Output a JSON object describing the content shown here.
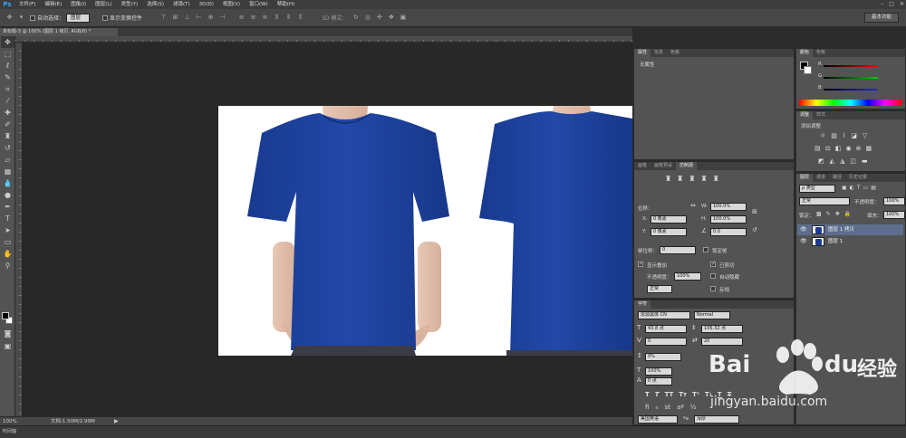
{
  "menubar": {
    "logo": "Ps",
    "items": [
      "文件(F)",
      "编辑(E)",
      "图像(I)",
      "图层(L)",
      "类型(Y)",
      "选择(S)",
      "滤镜(T)",
      "3D(D)",
      "视图(V)",
      "窗口(W)",
      "帮助(H)"
    ],
    "window_controls": [
      "–",
      "□",
      "✕"
    ]
  },
  "options": {
    "auto_select_label": "自动选择：",
    "auto_select_value": "图层",
    "show_transform_label": "显示变换控件",
    "mode_3d_label": "3D 模式：",
    "workspace": "基本功能"
  },
  "document": {
    "tab_title": "未标题-3 @ 100% (图层 1 拷贝, RGB/8) *"
  },
  "status": {
    "zoom": "100%",
    "doc_info": "文档:1.50M/2.99M",
    "timeline": "时间轴"
  },
  "panels": {
    "properties_tabs": [
      "属性",
      "信息",
      "色板"
    ],
    "properties_title": "无属性",
    "color_tabs": [
      "颜色",
      "色板"
    ],
    "color_labels": [
      "R",
      "G",
      "B"
    ],
    "adjust_tabs": [
      "调整",
      "样式"
    ],
    "adjust_title": "添加调整",
    "transform_tabs": [
      "画笔",
      "画笔预设",
      "仿制源"
    ],
    "offset_label": "位移：",
    "x_field": "0 像素",
    "y_field": "0 像素",
    "w_field": "100.0%",
    "h_field": "100.0%",
    "angle_field": "0.0",
    "frame_offset_label": "帧位移：",
    "frame_offset_value": "0",
    "lock_frame": "锁定帧",
    "show_overlay": "显示叠加",
    "opacity_label": "不透明度：",
    "opacity_value": "100%",
    "blend_value": "正常",
    "clipped": "已剪切",
    "auto_hide": "自动隐藏",
    "invert": "反相",
    "char_tabs": [
      "字符"
    ],
    "font_family": "思源黑体 CN",
    "font_style": "Normal",
    "font_size": "43.8 点",
    "leading": "106.32 点",
    "kerning": "0",
    "tracking": "20",
    "scale_v": "0%",
    "scale_h": "100%",
    "baseline": "0 点",
    "language": "美国英语",
    "aa_label": "ªa",
    "aa_value": "浑厚",
    "layers_tabs": [
      "图层",
      "通道",
      "路径",
      "历史记录"
    ],
    "layer_kind": "ρ 类型",
    "blend_mode": "正常",
    "layer_opacity_label": "不透明度：",
    "layer_opacity": "100%",
    "lock_label": "锁定：",
    "fill_label": "填充：",
    "fill_value": "100%",
    "layers": [
      {
        "name": "图层 1 拷贝",
        "selected": true
      },
      {
        "name": "图层 1",
        "selected": false
      }
    ]
  },
  "watermark": {
    "brand": "Bai",
    "brand2": "du",
    "text": "经验",
    "url": "jingyan.baidu.com"
  },
  "colors": {
    "shirt": "#1d3f99",
    "shirt_dark": "#142d73",
    "panel": "#535353",
    "selected_layer": "#5c6e8c"
  }
}
